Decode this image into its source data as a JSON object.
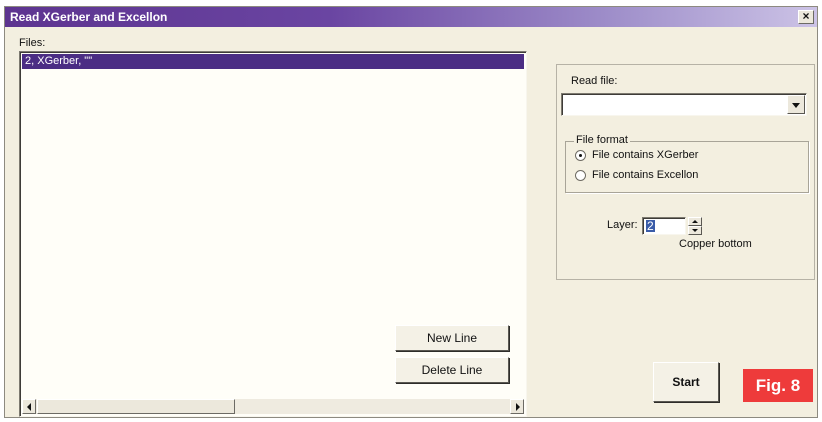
{
  "window": {
    "title": "Read XGerber and Excellon",
    "close_glyph": "×"
  },
  "files": {
    "label": "Files:",
    "items": [
      "2, XGerber, \"\""
    ]
  },
  "buttons": {
    "new_line": "New Line",
    "delete_line": "Delete Line",
    "start": "Start"
  },
  "read_file": {
    "label": "Read file:",
    "value": ""
  },
  "file_format": {
    "legend": "File format",
    "options": [
      "File contains XGerber",
      "File contains Excellon"
    ],
    "selected_index": 0
  },
  "layer": {
    "label": "Layer:",
    "value": "2",
    "name": "Copper bottom"
  },
  "figure": {
    "badge": "Fig. 8"
  },
  "icons": {
    "close": "close-icon",
    "dropdown": "chevron-down-icon",
    "scroll_left": "arrow-left-icon",
    "scroll_right": "arrow-right-icon",
    "spin_up": "arrow-up-icon",
    "spin_down": "arrow-down-icon"
  },
  "colors": {
    "title_start": "#5d3490",
    "title_end": "#ccc3e6",
    "selection": "#4b2d84",
    "window_bg": "#f3efe0",
    "badge": "#ee3b3b"
  }
}
